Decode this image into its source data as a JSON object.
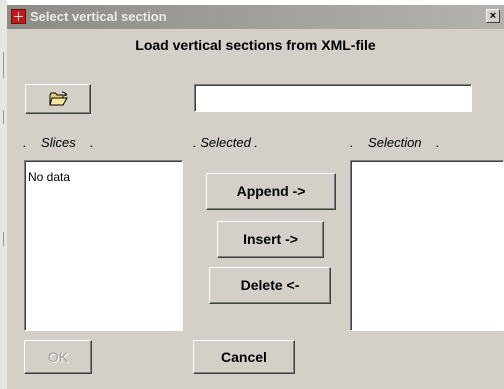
{
  "window": {
    "title": "Select vertical section",
    "close_label": "×"
  },
  "heading": "Load vertical sections from XML-file",
  "path_input": {
    "value": "",
    "placeholder": ""
  },
  "columns": {
    "slices_label": ".    Slices    .",
    "selected_label": ". Selected .",
    "selection_label": ".    Selection    ."
  },
  "slices_list": {
    "items": [
      "No data"
    ]
  },
  "selection_list": {
    "items": []
  },
  "buttons": {
    "open_folder_icon": "open-folder-icon",
    "append": "Append  ->",
    "insert": "Insert ->",
    "delete": "Delete  <-",
    "ok": "OK",
    "cancel": "Cancel"
  },
  "colors": {
    "face": "#d4d0c8",
    "title_text": "#ecebe6",
    "disabled_text": "#a19f99"
  }
}
